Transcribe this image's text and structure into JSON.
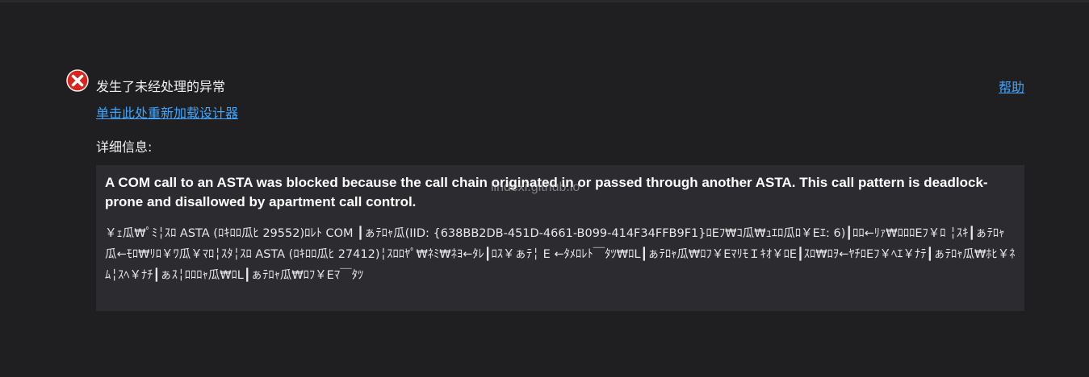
{
  "error": {
    "icon": "error-x-icon",
    "icon_color": "#d9261c",
    "title": "发生了未经处理的异常",
    "reload_link": "单击此处重新加载设计器",
    "help_link": "帮助"
  },
  "details": {
    "label": "详细信息:",
    "heading": "A COM call to an ASTA was blocked because the call chain originated in or passed through another ASTA. This call pattern is deadlock-prone and disallowed by apartment call control.",
    "body": "￥ｪ瓜₩ﾟﾐ╎ｽﾛ ASTA (ﾛｷﾛﾛ瓜ﾋ 29552)ﾛﾚﾄ COM ┃ぁﾃﾛｬ瓜(IID: {638BB2DB-451D-4661-B099-414F34FFB9F1}ﾛEﾌ₩ｺ瓜₩ｭｴﾛ瓜ﾛ￥Eｴ: 6)┃ﾛﾛ←ﾘｧ₩ﾛﾛﾛEﾌ￥ﾛ ╎ｽｷ┃ぁﾃﾛｬ瓜←ﾓﾛ₩ﾘﾛ￥ﾜ瓜￥ﾏﾛ╎ｽﾀ╎ｽﾛ ASTA (ﾛｷﾛﾛ瓜ﾋ 27412)╎ｽﾛﾛﾔﾟ₩ﾈﾐ₩ﾈﾖ←ﾀﾚ┃ﾛｽ￥ぁﾃ╎ E ←ﾀﾒﾛﾚﾄ￣ﾀﾂ₩ﾛL┃ぁﾃﾛｬ瓜₩ﾛﾌ￥EﾏﾘﾓＩｷｵ￥ﾛE┃ｽﾛ₩ﾛｦ←ﾔﾁﾛEﾌ￥ﾍｴ￥ﾅﾃ┃ぁﾃﾛｬ瓜₩ﾎﾋ￥ﾈﾑ╎ｽﾍ￥ﾅﾁ┃ぁｽ╎ﾛﾛﾛｬ瓜₩ﾛL┃ぁﾃﾛｬ瓜₩ﾛﾌ￥Eﾏ￣ﾀﾂ"
  },
  "watermark": "lindexi.github.io"
}
